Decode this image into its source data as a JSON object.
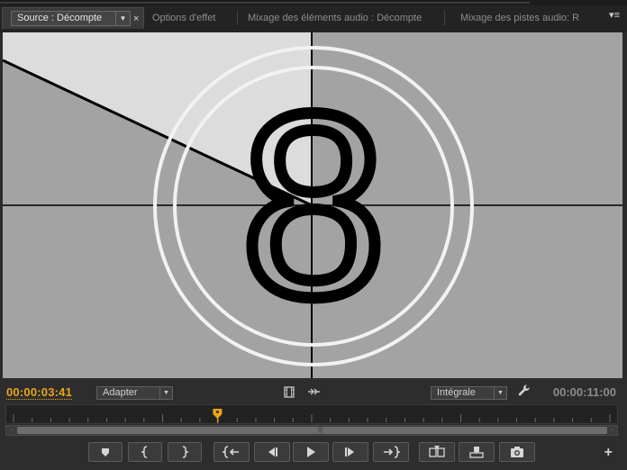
{
  "tabs": {
    "source": "Source : Décompte",
    "effect_options": "Options d'effet",
    "audio_clip_mixer": "Mixage des éléments audio : Décompte",
    "audio_track_mixer": "Mixage des pistes audio: R"
  },
  "viewer": {
    "countdown_number": "8"
  },
  "controls": {
    "current_timecode": "00:00:03:41",
    "zoom_select": "Adapter",
    "resolution_select": "Intégrale",
    "duration_timecode": "00:00:11:00",
    "playhead_position_fraction": 0.342
  },
  "icons": {
    "tab_close": "close-icon",
    "panel_menu": "panel-menu-icon",
    "film": "film-icon",
    "export_frame": "camera-icon",
    "settings": "wrench-icon",
    "add": "plus-icon"
  }
}
